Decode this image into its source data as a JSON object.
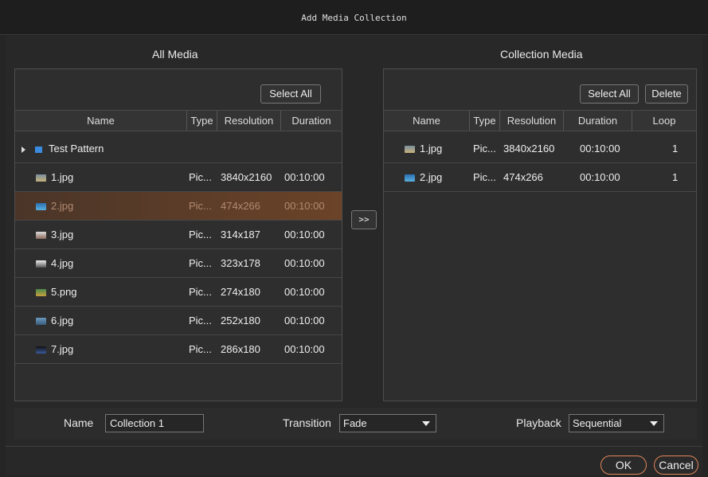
{
  "window": {
    "title": "Add Media Collection"
  },
  "all_media": {
    "heading": "All Media",
    "select_all": "Select All",
    "columns": [
      "Name",
      "Type",
      "Resolution",
      "Duration"
    ],
    "folder": "Test Pattern",
    "rows": [
      {
        "name": "1.jpg",
        "type": "Pic...",
        "resolution": "3840x2160",
        "duration": "00:10:00"
      },
      {
        "name": "2.jpg",
        "type": "Pic...",
        "resolution": "474x266",
        "duration": "00:10:00"
      },
      {
        "name": "3.jpg",
        "type": "Pic...",
        "resolution": "314x187",
        "duration": "00:10:00"
      },
      {
        "name": "4.jpg",
        "type": "Pic...",
        "resolution": "323x178",
        "duration": "00:10:00"
      },
      {
        "name": "5.png",
        "type": "Pic...",
        "resolution": "274x180",
        "duration": "00:10:00"
      },
      {
        "name": "6.jpg",
        "type": "Pic...",
        "resolution": "252x180",
        "duration": "00:10:00"
      },
      {
        "name": "7.jpg",
        "type": "Pic...",
        "resolution": "286x180",
        "duration": "00:10:00"
      }
    ],
    "selected_row": "2.jpg"
  },
  "move_button": ">>",
  "collection_media": {
    "heading": "Collection Media",
    "select_all": "Select All",
    "delete": "Delete",
    "columns": [
      "Name",
      "Type",
      "Resolution",
      "Duration",
      "Loop"
    ],
    "rows": [
      {
        "name": "1.jpg",
        "type": "Pic...",
        "resolution": "3840x2160",
        "duration": "00:10:00",
        "loop": "1"
      },
      {
        "name": "2.jpg",
        "type": "Pic...",
        "resolution": "474x266",
        "duration": "00:10:00",
        "loop": "1"
      }
    ]
  },
  "form": {
    "name_label": "Name",
    "name_value": "Collection 1",
    "transition_label": "Transition",
    "transition_value": "Fade",
    "playback_label": "Playback",
    "playback_value": "Sequential"
  },
  "footer": {
    "ok": "OK",
    "cancel": "Cancel"
  },
  "colors": {
    "accent": "#e0855a",
    "selection": "#6b4328",
    "folder": "#3a8be0"
  }
}
